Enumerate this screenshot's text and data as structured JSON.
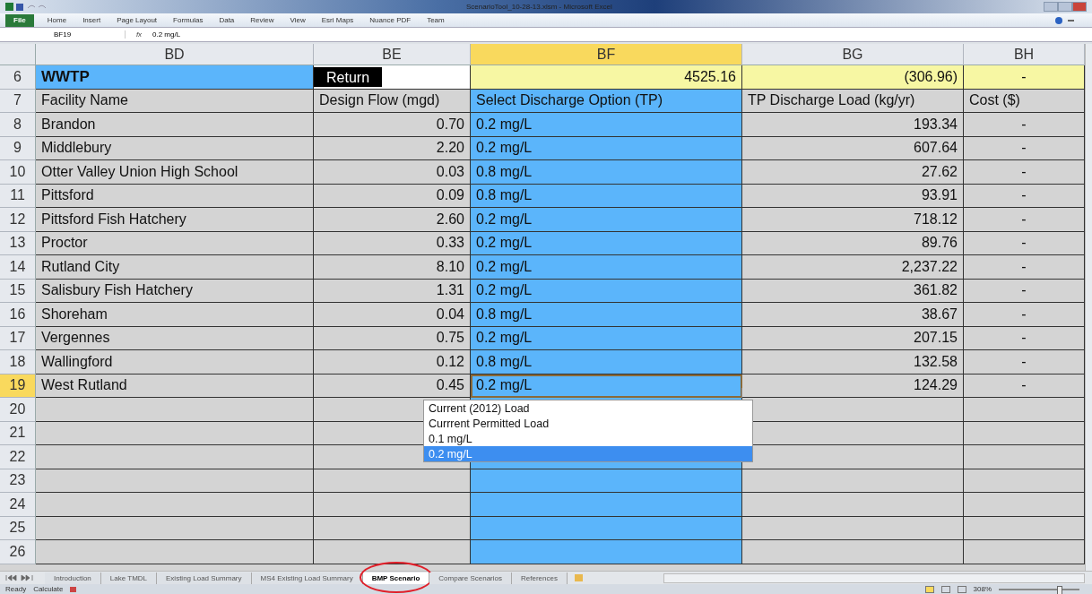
{
  "window": {
    "title": "ScenarioTool_10-28-13.xlsm - Microsoft Excel"
  },
  "ribbon": {
    "file_tab": "File",
    "tabs": [
      "Home",
      "Insert",
      "Page Layout",
      "Formulas",
      "Data",
      "Review",
      "View",
      "Esri Maps",
      "Nuance PDF",
      "Team"
    ]
  },
  "formula_bar": {
    "name_box": "BF19",
    "fx_label": "fx",
    "formula": "0.2 mg/L"
  },
  "columns": [
    {
      "label": "BD",
      "selected": false
    },
    {
      "label": "BE",
      "selected": false
    },
    {
      "label": "BF",
      "selected": true
    },
    {
      "label": "BG",
      "selected": false
    },
    {
      "label": "BH",
      "selected": false
    }
  ],
  "title_row": {
    "number": "6",
    "title": "WWTP",
    "button": "Return",
    "total_flow": "4525.16",
    "total_load": "(306.96)",
    "total_cost": "-"
  },
  "header_row": {
    "number": "7",
    "cells": [
      "Facility Name",
      "Design Flow (mgd)",
      "Select Discharge Option (TP)",
      "TP Discharge Load (kg/yr)",
      "Cost ($)"
    ]
  },
  "rows": [
    {
      "number": "8",
      "selected": false,
      "facility": "Brandon",
      "flow": "0.70",
      "option": "0.2 mg/L",
      "load": "193.34",
      "cost": "-"
    },
    {
      "number": "9",
      "selected": false,
      "facility": "Middlebury",
      "flow": "2.20",
      "option": "0.2 mg/L",
      "load": "607.64",
      "cost": "-"
    },
    {
      "number": "10",
      "selected": false,
      "facility": "Otter Valley Union High School",
      "flow": "0.03",
      "option": "0.8 mg/L",
      "load": "27.62",
      "cost": "-"
    },
    {
      "number": "11",
      "selected": false,
      "facility": "Pittsford",
      "flow": "0.09",
      "option": "0.8 mg/L",
      "load": "93.91",
      "cost": "-"
    },
    {
      "number": "12",
      "selected": false,
      "facility": "Pittsford Fish Hatchery",
      "flow": "2.60",
      "option": "0.2 mg/L",
      "load": "718.12",
      "cost": "-"
    },
    {
      "number": "13",
      "selected": false,
      "facility": "Proctor",
      "flow": "0.33",
      "option": "0.2 mg/L",
      "load": "89.76",
      "cost": "-"
    },
    {
      "number": "14",
      "selected": false,
      "facility": "Rutland City",
      "flow": "8.10",
      "option": "0.2 mg/L",
      "load": "2,237.22",
      "cost": "-"
    },
    {
      "number": "15",
      "selected": false,
      "facility": "Salisbury Fish Hatchery",
      "flow": "1.31",
      "option": "0.2 mg/L",
      "load": "361.82",
      "cost": "-"
    },
    {
      "number": "16",
      "selected": false,
      "facility": "Shoreham",
      "flow": "0.04",
      "option": "0.8 mg/L",
      "load": "38.67",
      "cost": "-"
    },
    {
      "number": "17",
      "selected": false,
      "facility": "Vergennes",
      "flow": "0.75",
      "option": "0.2 mg/L",
      "load": "207.15",
      "cost": "-"
    },
    {
      "number": "18",
      "selected": false,
      "facility": "Wallingford",
      "flow": "0.12",
      "option": "0.8 mg/L",
      "load": "132.58",
      "cost": "-"
    },
    {
      "number": "19",
      "selected": true,
      "facility": "West Rutland",
      "flow": "0.45",
      "option": "0.2 mg/L",
      "load": "124.29",
      "cost": "-"
    }
  ],
  "empty_rows": [
    "20",
    "21",
    "22",
    "23",
    "24",
    "25",
    "26"
  ],
  "dropdown": {
    "items": [
      {
        "label": "Current (2012) Load",
        "selected": false
      },
      {
        "label": "Currrent Permitted Load",
        "selected": false
      },
      {
        "label": "0.1 mg/L",
        "selected": false
      },
      {
        "label": "0.2 mg/L",
        "selected": true
      }
    ]
  },
  "sheet_tabs": [
    {
      "label": "Introduction",
      "selected": false
    },
    {
      "label": "Lake TMDL",
      "selected": false
    },
    {
      "label": "Existing Load Summary",
      "selected": false
    },
    {
      "label": "MS4 Existing Load Summary",
      "selected": false
    },
    {
      "label": "BMP Scenario",
      "selected": true
    },
    {
      "label": "Compare Scenarios",
      "selected": false
    },
    {
      "label": "References",
      "selected": false
    }
  ],
  "status_bar": {
    "mode": "Ready",
    "calculate": "Calculate",
    "zoom": "308%",
    "level": 0.75
  }
}
